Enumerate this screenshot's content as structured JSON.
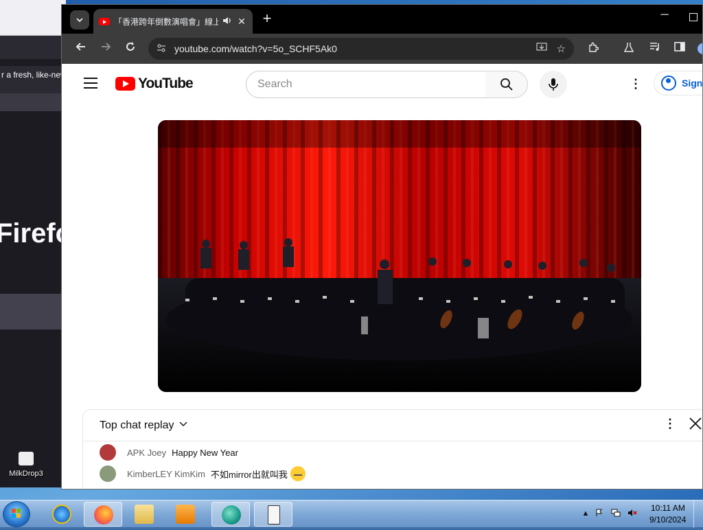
{
  "background_window": {
    "snippet_text": "r a fresh, like-new",
    "hero_text": "Firefo"
  },
  "desktop": {
    "icon_label": "MilkDrop3"
  },
  "chrome": {
    "tab": {
      "title": "「香港跨年倒數演唱會」線上",
      "audio_icon": "speaker-icon",
      "close_icon": "close-icon"
    },
    "new_tab_label": "+",
    "address": "youtube.com/watch?v=5o_SCHF5Ak0"
  },
  "youtube": {
    "logo_text": "YouTube",
    "search_placeholder": "Search",
    "sign_in_label": "Sign"
  },
  "chat": {
    "title": "Top chat replay",
    "messages": [
      {
        "author": "APK Joey",
        "text": "Happy New Year",
        "avatar_color": "#b23a3a"
      },
      {
        "author": "KimberLEY KimKim",
        "text": "不如mirror出就叫我",
        "avatar_color": "#8a9a7a"
      }
    ]
  },
  "taskbar": {
    "time": "10:11 AM",
    "date": "9/10/2024",
    "apps": [
      "internet-explorer",
      "firefox",
      "file-explorer",
      "media-player",
      "browser-app",
      "notepad-app"
    ]
  },
  "colors": {
    "youtube_red": "#ff0000",
    "chrome_dark": "#3c3c3c",
    "link_blue": "#065fd4"
  }
}
